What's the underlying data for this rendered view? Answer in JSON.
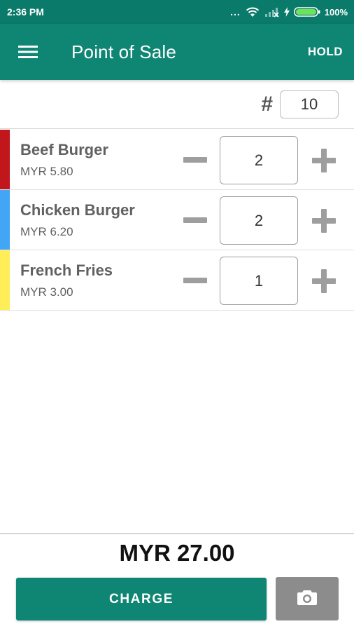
{
  "status_bar": {
    "time": "2:36 PM",
    "dots": "...",
    "battery_percent": "100%"
  },
  "app_bar": {
    "menu_icon": "hamburger-menu-icon",
    "title": "Point of Sale",
    "hold_label": "HOLD"
  },
  "order": {
    "hash_symbol": "#",
    "number": "10"
  },
  "items": [
    {
      "name": "Beef Burger",
      "price": "MYR 5.80",
      "quantity": "2",
      "color": "#c0161c"
    },
    {
      "name": "Chicken Burger",
      "price": "MYR 6.20",
      "quantity": "2",
      "color": "#42a5f5"
    },
    {
      "name": "French Fries",
      "price": "MYR 3.00",
      "quantity": "1",
      "color": "#ffee58"
    }
  ],
  "total": "MYR 27.00",
  "charge_label": "CHARGE",
  "camera_icon": "camera-icon",
  "colors": {
    "primary": "#0f8674",
    "status_bar": "#0a7a6a",
    "camera_button": "#8c8c8c"
  }
}
